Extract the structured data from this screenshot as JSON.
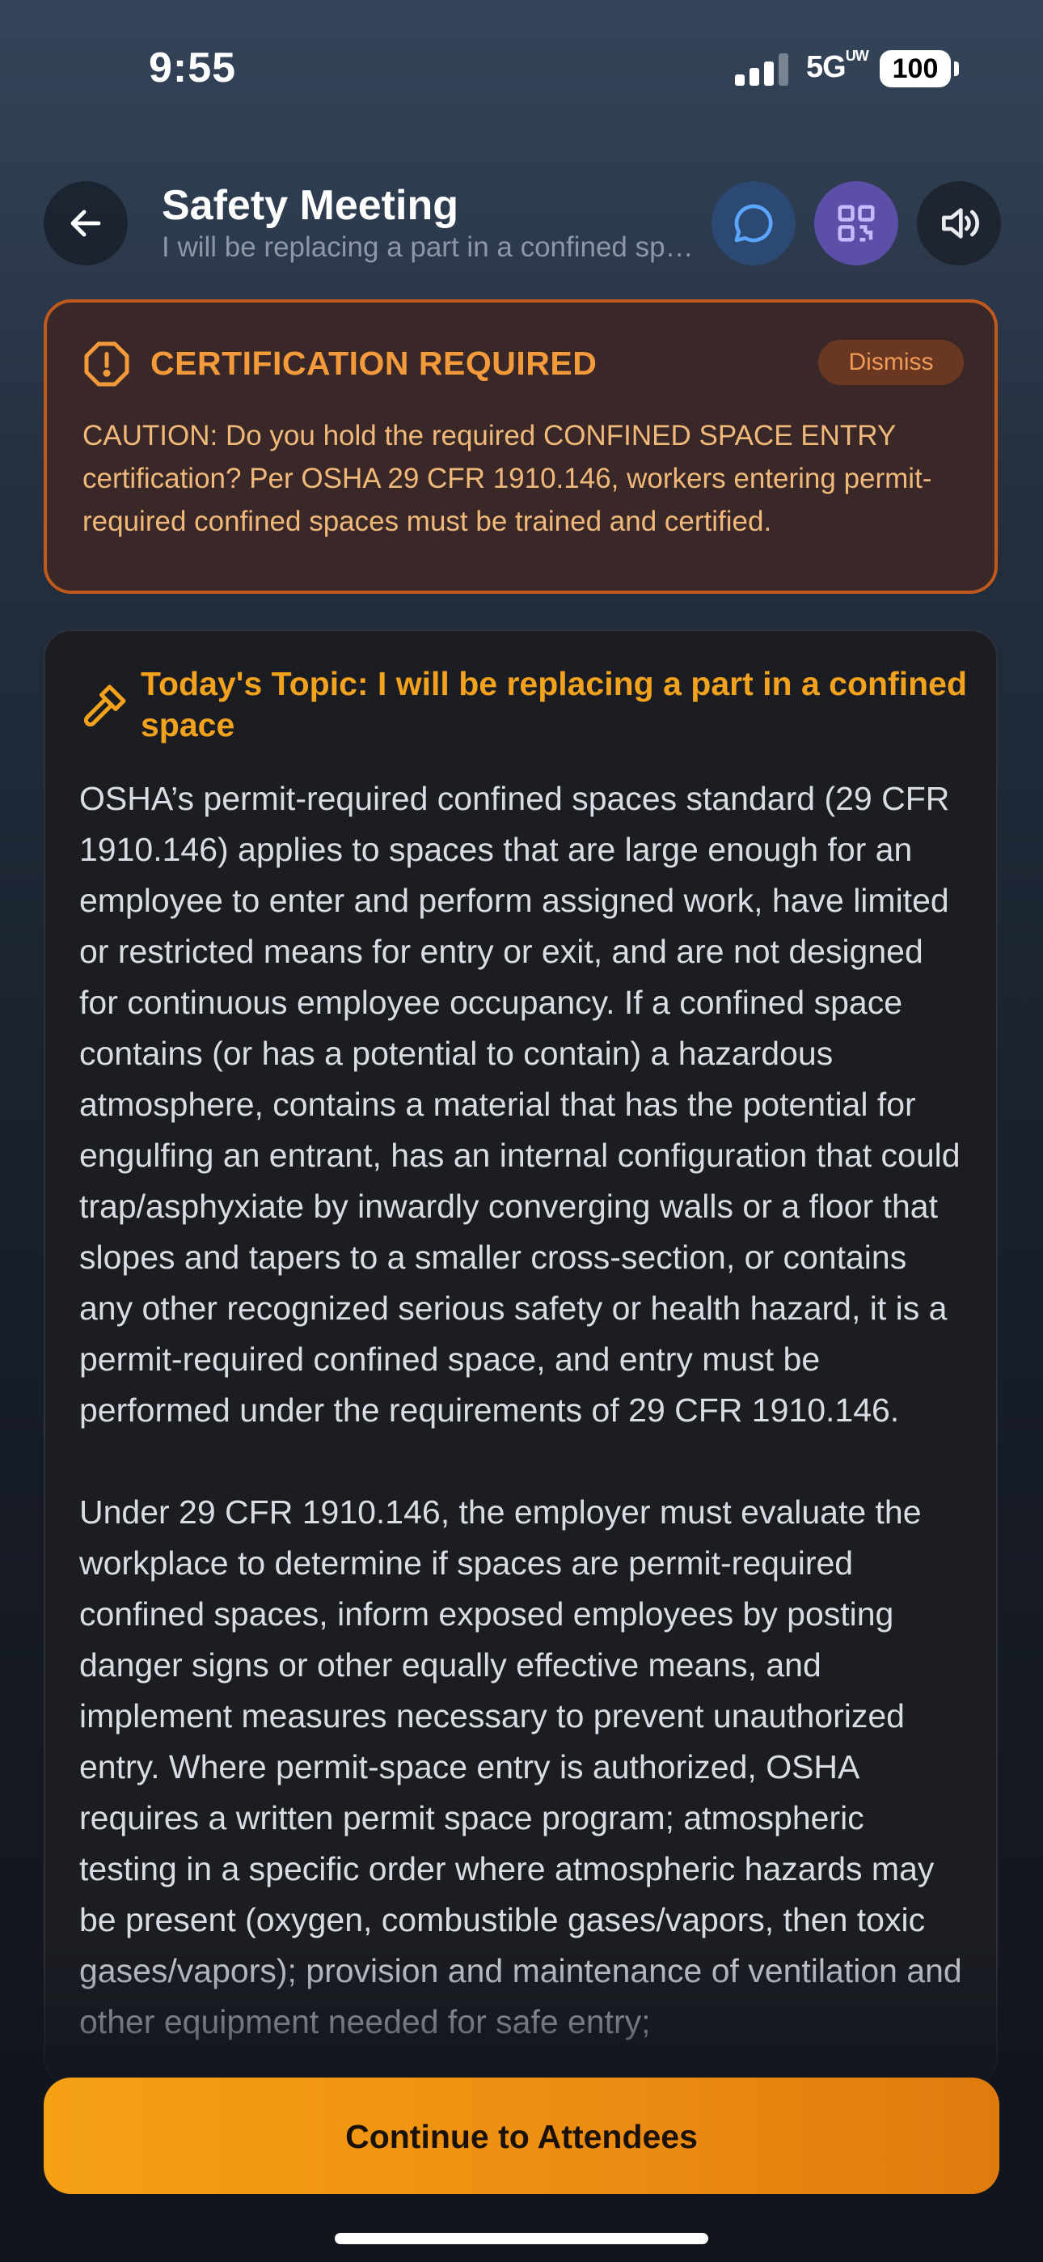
{
  "status_bar": {
    "time": "9:55",
    "network": "5G",
    "network_suffix": "UW",
    "battery": "100"
  },
  "header": {
    "title": "Safety Meeting",
    "subtitle": "I will be replacing a part in a confined space"
  },
  "alert": {
    "title": "CERTIFICATION REQUIRED",
    "dismiss_label": "Dismiss",
    "body": "CAUTION: Do you hold the required CONFINED SPACE ENTRY certification? Per OSHA 29 CFR 1910.146, workers entering permit-required confined spaces must be trained and certified.",
    "border_color": "#c2591c",
    "text_color": "#f0b97a"
  },
  "topic": {
    "title": "Today's Topic: I will be replacing a part in a confined space",
    "paragraphs": [
      "OSHA’s permit-required confined spaces standard (29 CFR 1910.146) applies to spaces that are large enough for an employee to enter and perform assigned work, have limited or restricted means for entry or exit, and are not designed for continuous employee occupancy. If a confined space contains (or has a potential to contain) a hazardous atmosphere, contains a material that has the potential for engulfing an entrant, has an internal configuration that could trap/asphyxiate by inwardly converging walls or a floor that slopes and tapers to a smaller cross-section, or contains any other recognized serious safety or health hazard, it is a permit-required confined space, and entry must be performed under the requirements of 29 CFR 1910.146.",
      "Under 29 CFR 1910.146, the employer must evaluate the workplace to determine if spaces are permit-required confined spaces, inform exposed employees by posting danger signs or other equally effective means, and implement measures necessary to prevent unauthorized entry. Where permit-space entry is authorized, OSHA requires a written permit space program; atmospheric testing in a specific order where atmospheric hazards may be present (oxygen, combustible gases/vapors, then toxic gases/vapors); provision and maintenance of ventilation and other equipment needed for safe entry;"
    ],
    "accent_color": "#f3a21d"
  },
  "cta": {
    "label": "Continue to Attendees",
    "color": "#f5a114"
  },
  "icons": {
    "back": "arrow-left-icon",
    "chat": "chat-bubble-icon",
    "qr": "qr-code-icon",
    "sound": "speaker-icon",
    "alert": "exclamation-octagon-icon",
    "topic": "hammer-icon"
  }
}
